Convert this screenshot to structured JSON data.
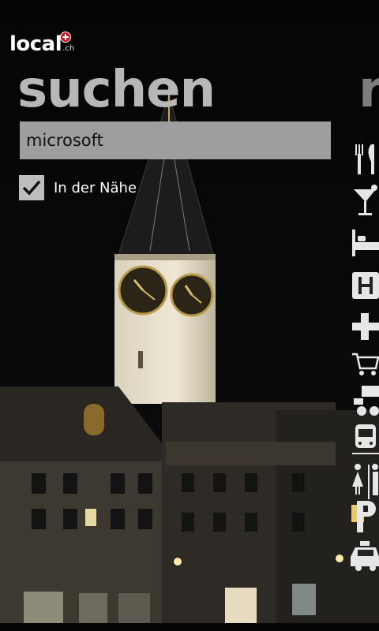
{
  "app": {
    "logo_text": "local",
    "logo_tld": ".ch",
    "logo_accent": "#d0111b"
  },
  "pivot": {
    "title": "suchen",
    "next_title": "r"
  },
  "search": {
    "value": "microsoft"
  },
  "nearby": {
    "label": "In der Nähe",
    "checked": true
  },
  "categories": [
    {
      "icon": "restaurant-icon"
    },
    {
      "icon": "bar-cocktail-icon"
    },
    {
      "icon": "hotel-bed-icon"
    },
    {
      "icon": "hospital-icon"
    },
    {
      "icon": "pharmacy-cross-icon"
    },
    {
      "icon": "shopping-cart-icon"
    },
    {
      "icon": "truck-delivery-icon"
    },
    {
      "icon": "train-icon"
    },
    {
      "icon": "restroom-icon"
    },
    {
      "icon": "parking-icon"
    },
    {
      "icon": "taxi-icon"
    }
  ],
  "theme": {
    "background": "#000000",
    "title_color": "#b7b7b7",
    "field_background": "#9e9e9e"
  }
}
